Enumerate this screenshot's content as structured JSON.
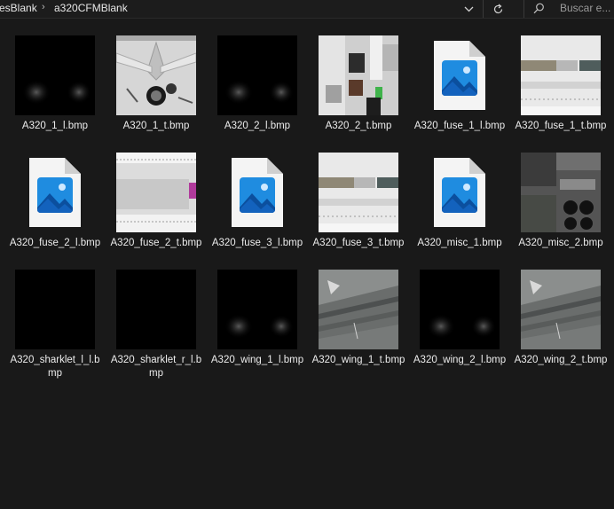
{
  "breadcrumb": {
    "parent": "esBlank",
    "current": "a320CFMBlank"
  },
  "toolbar": {
    "dropdown_icon": "chevron-down-icon",
    "refresh_icon": "refresh-icon"
  },
  "search": {
    "placeholder": "Buscar e..."
  },
  "files": [
    {
      "name": "A320_1_l.bmp",
      "thumb": "dark-light"
    },
    {
      "name": "A320_1_t.bmp",
      "thumb": "tail-texture"
    },
    {
      "name": "A320_2_l.bmp",
      "thumb": "dark-light"
    },
    {
      "name": "A320_2_t.bmp",
      "thumb": "parts-texture"
    },
    {
      "name": "A320_fuse_1_l.bmp",
      "thumb": "image-file-icon"
    },
    {
      "name": "A320_fuse_1_t.bmp",
      "thumb": "fuse-texture"
    },
    {
      "name": "A320_fuse_2_l.bmp",
      "thumb": "image-file-icon"
    },
    {
      "name": "A320_fuse_2_t.bmp",
      "thumb": "fuse-strip-texture"
    },
    {
      "name": "A320_fuse_3_l.bmp",
      "thumb": "image-file-icon"
    },
    {
      "name": "A320_fuse_3_t.bmp",
      "thumb": "fuse-texture"
    },
    {
      "name": "A320_misc_1.bmp",
      "thumb": "image-file-icon"
    },
    {
      "name": "A320_misc_2.bmp",
      "thumb": "misc-texture"
    },
    {
      "name": "A320_sharklet_l_l.bmp",
      "thumb": "black"
    },
    {
      "name": "A320_sharklet_r_l.bmp",
      "thumb": "black"
    },
    {
      "name": "A320_wing_1_l.bmp",
      "thumb": "dark-light"
    },
    {
      "name": "A320_wing_1_t.bmp",
      "thumb": "wing-texture"
    },
    {
      "name": "A320_wing_2_l.bmp",
      "thumb": "dark-light"
    },
    {
      "name": "A320_wing_2_t.bmp",
      "thumb": "wing-texture"
    }
  ],
  "colors": {
    "background": "#191919",
    "text": "#ececec",
    "icon_blue": "#1f8ce0"
  }
}
